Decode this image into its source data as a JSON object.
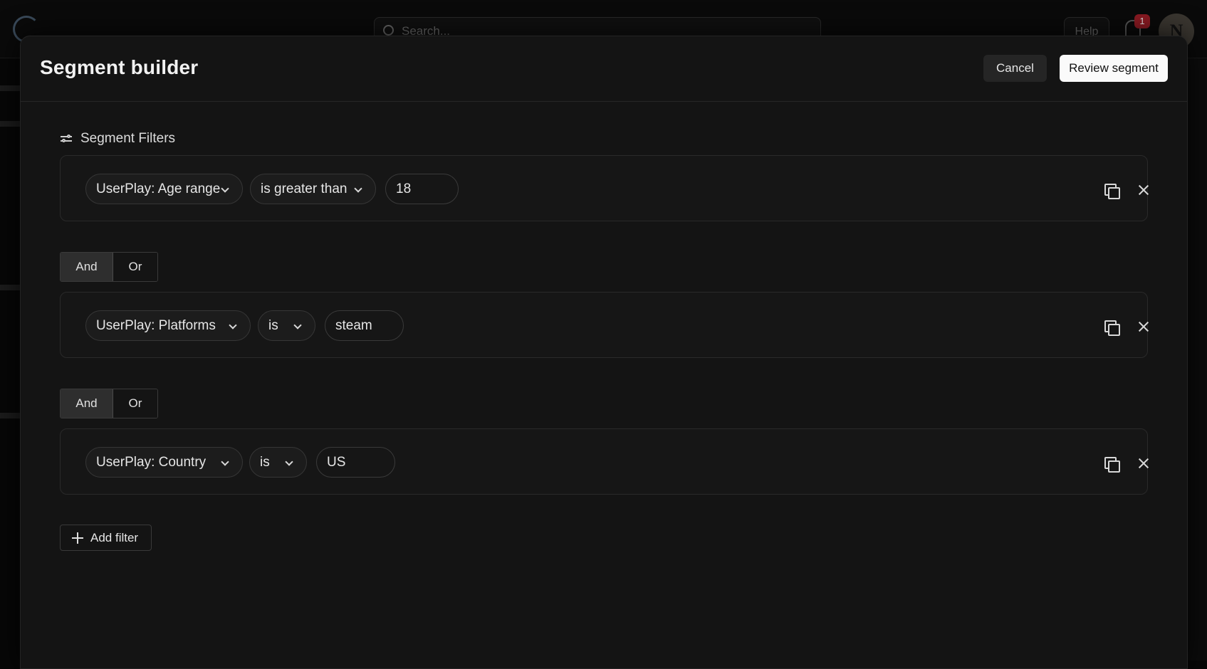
{
  "background": {
    "search_placeholder": "Search...",
    "help_label": "Help",
    "notification_count": "1",
    "avatar_initial": "N"
  },
  "modal": {
    "title": "Segment builder",
    "cancel_label": "Cancel",
    "review_label": "Review segment",
    "section_label": "Segment Filters",
    "add_filter_label": "Add filter"
  },
  "filters": [
    {
      "field": "UserPlay: Age range",
      "operator": "is greater than",
      "value": "18"
    },
    {
      "field": "UserPlay: Platforms",
      "operator": "is",
      "value": "steam"
    },
    {
      "field": "UserPlay: Country",
      "operator": "is",
      "value": "US"
    }
  ],
  "logic": [
    {
      "and_label": "And",
      "or_label": "Or",
      "selected": "And"
    },
    {
      "and_label": "And",
      "or_label": "Or",
      "selected": "And"
    }
  ],
  "icons": {
    "filter_section": "sliders-icon",
    "duplicate": "duplicate-icon",
    "remove": "close-icon",
    "dropdown": "chevron-down-icon",
    "add": "plus-icon"
  },
  "colors": {
    "modal_bg": "#141414",
    "primary_button_bg": "#fafafa",
    "secondary_button_bg": "#252525",
    "selected_logic_bg": "#2e2e2e",
    "notification_badge": "#8a1a22"
  }
}
